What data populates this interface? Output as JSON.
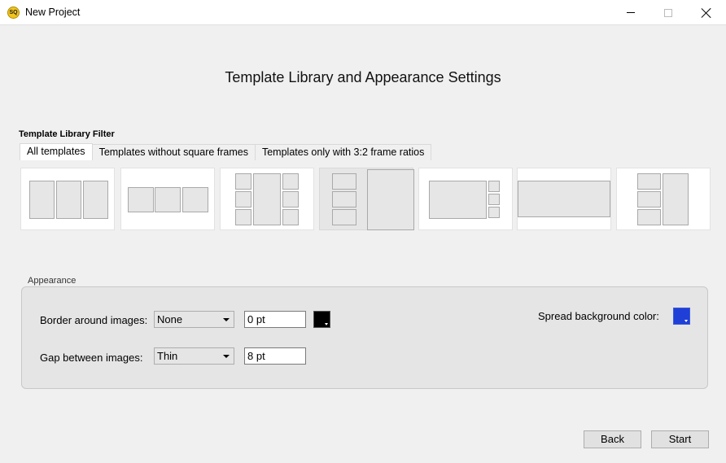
{
  "window": {
    "title": "New Project",
    "icon": "app-logo-icon",
    "icon_text": "SQ"
  },
  "page": {
    "title": "Template Library and Appearance Settings"
  },
  "filter": {
    "label": "Template Library Filter",
    "tabs": [
      {
        "label": "All templates",
        "active": true
      },
      {
        "label": "Templates without square frames",
        "active": false
      },
      {
        "label": "Templates only with 3:2 frame ratios",
        "active": false
      }
    ]
  },
  "templates": {
    "selected_index": 3,
    "count": 7
  },
  "appearance": {
    "label": "Appearance",
    "border": {
      "label": "Border around images:",
      "style_value": "None",
      "width_value": "0 pt",
      "color": "#000000"
    },
    "gap": {
      "label": "Gap between images:",
      "style_value": "Thin",
      "width_value": "8 pt"
    },
    "spread": {
      "label": "Spread background color:",
      "color": "#1f3fd6"
    }
  },
  "buttons": {
    "back": "Back",
    "start": "Start"
  },
  "colors": {
    "window_bg": "#f0f0f0",
    "panel_bg": "#e5e5e5",
    "frame_fill": "#e6e6e6"
  }
}
